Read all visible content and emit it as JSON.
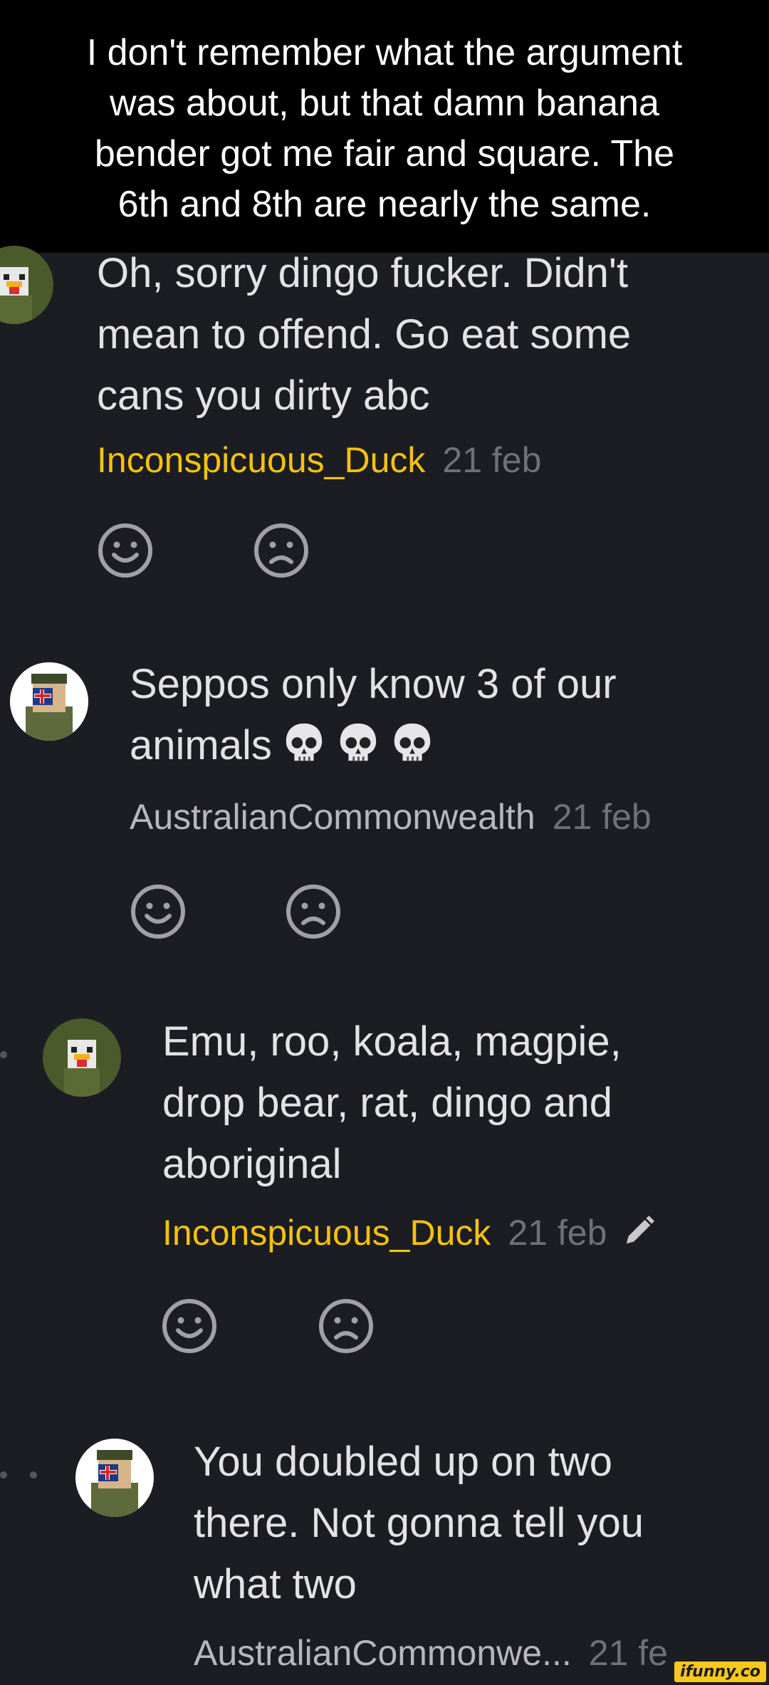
{
  "caption": {
    "lines": [
      "I don't remember what the argument",
      "was about, but that damn banana",
      "bender got me fair and square. The",
      "6th and 8th are nearly the same."
    ]
  },
  "comments": [
    {
      "lines": [
        "Oh, sorry dingo fucker. Didn't",
        "mean to offend. Go eat some",
        "cans you dirty abc"
      ],
      "username": "Inconspicuous_Duck",
      "date": "21 feb",
      "avatar_icon": "duck-avatar-icon"
    },
    {
      "lines": [
        "Seppos only know 3 of our",
        "animals"
      ],
      "emoji": "skull-icon x3",
      "username": "AustralianCommonwealth",
      "date": "21 feb",
      "avatar_icon": "soldier-avatar-icon"
    },
    {
      "lines": [
        "Emu, roo, koala, magpie,",
        "drop bear, rat, dingo and",
        "aboriginal"
      ],
      "username": "Inconspicuous_Duck",
      "date": "21 feb",
      "edited_icon": "pencil-icon",
      "avatar_icon": "duck-avatar-icon"
    },
    {
      "lines": [
        "You doubled up on two",
        "there. Not gonna tell you",
        "what two"
      ],
      "username": "AustralianCommonwe...",
      "date": "21 fe",
      "avatar_icon": "soldier-avatar-icon"
    }
  ],
  "watermark": "ifunny.co",
  "colors": {
    "background": "#1c1d22",
    "username_highlight": "#f4c20d",
    "username_plain": "#b8b8bc",
    "text": "#e3e3e6",
    "date": "#707078"
  }
}
